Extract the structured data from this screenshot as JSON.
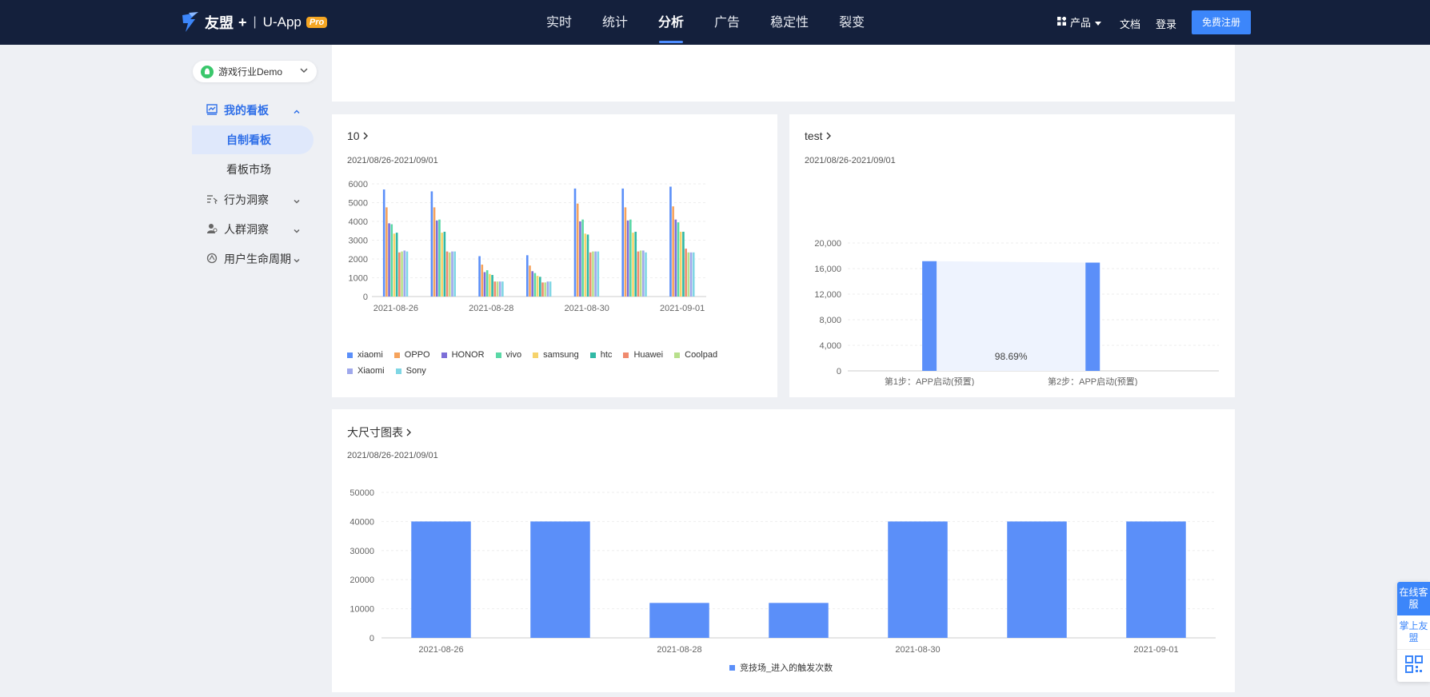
{
  "header": {
    "brand": "友盟",
    "plus": "+",
    "separator": "|",
    "product": "U-App",
    "badge": "Pro",
    "nav": [
      {
        "label": "实时",
        "active": false
      },
      {
        "label": "统计",
        "active": false
      },
      {
        "label": "分析",
        "active": true
      },
      {
        "label": "广告",
        "active": false
      },
      {
        "label": "稳定性",
        "active": false
      },
      {
        "label": "裂变",
        "active": false
      }
    ],
    "products_label": "产品",
    "docs_label": "文档",
    "login_label": "登录",
    "signup_label": "免费注册"
  },
  "sidebar": {
    "app_name": "游戏行业Demo",
    "groups": [
      {
        "label": "我的看板",
        "icon": "dashboard-icon",
        "expanded": true
      },
      {
        "label": "行为洞察",
        "icon": "behavior-icon",
        "expanded": false
      },
      {
        "label": "人群洞察",
        "icon": "people-icon",
        "expanded": false
      },
      {
        "label": "用户生命周期",
        "icon": "lifecycle-icon",
        "expanded": false
      }
    ],
    "sub_items": [
      {
        "label": "自制看板",
        "active": true
      },
      {
        "label": "看板市场",
        "active": false
      }
    ]
  },
  "cards": {
    "card1": {
      "title": "10",
      "date": "2021/08/26-2021/09/01"
    },
    "card2": {
      "title": "test",
      "date": "2021/08/26-2021/09/01"
    },
    "card3": {
      "title": "大尺寸图表",
      "date": "2021/08/26-2021/09/01"
    }
  },
  "chart_data": [
    {
      "type": "bar",
      "x_ticks": [
        "2021-08-26",
        "2021-08-28",
        "2021-08-30",
        "2021-09-01"
      ],
      "categories": [
        "2021-08-26",
        "2021-08-27",
        "2021-08-28",
        "2021-08-29",
        "2021-08-30",
        "2021-08-31",
        "2021-09-01"
      ],
      "ylim": [
        0,
        6000
      ],
      "yticks": [
        0,
        1000,
        2000,
        3000,
        4000,
        5000,
        6000
      ],
      "legend_position": "bottom",
      "series": [
        {
          "name": "xiaomi",
          "color": "#5b8ff9",
          "values": [
            5700,
            5600,
            2150,
            2200,
            5750,
            5750,
            5850
          ]
        },
        {
          "name": "OPPO",
          "color": "#f6a35c",
          "values": [
            4750,
            4750,
            1700,
            1650,
            4950,
            4750,
            4800
          ]
        },
        {
          "name": "HONOR",
          "color": "#7c6fd8",
          "values": [
            3900,
            4050,
            1300,
            1350,
            4000,
            4050,
            4100
          ]
        },
        {
          "name": "vivo",
          "color": "#5ad8a6",
          "values": [
            3850,
            4100,
            1400,
            1250,
            4100,
            4100,
            3950
          ]
        },
        {
          "name": "samsung",
          "color": "#f6d36c",
          "values": [
            3350,
            3400,
            1200,
            1100,
            3350,
            3400,
            3450
          ]
        },
        {
          "name": "htc",
          "color": "#30b9a5",
          "values": [
            3400,
            3450,
            1150,
            1050,
            3300,
            3450,
            3450
          ]
        },
        {
          "name": "Huawei",
          "color": "#f08a6e",
          "values": [
            2350,
            2400,
            800,
            750,
            2350,
            2400,
            2550
          ]
        },
        {
          "name": "Coolpad",
          "color": "#b8e08c",
          "values": [
            2400,
            2350,
            800,
            750,
            2400,
            2450,
            2350
          ]
        },
        {
          "name": "Xiaomi",
          "color": "#9fa8ec",
          "values": [
            2450,
            2400,
            800,
            800,
            2400,
            2450,
            2350
          ]
        },
        {
          "name": "Sony",
          "color": "#7fd6e4",
          "values": [
            2400,
            2400,
            800,
            800,
            2400,
            2350,
            2350
          ]
        }
      ]
    },
    {
      "type": "bar",
      "categories": [
        "第1步：APP启动(预置)",
        "第2步：APP启动(预置)"
      ],
      "values": [
        17155,
        16931
      ],
      "value_labels": [
        "17,155",
        "16,931"
      ],
      "conversion_rate": "98.69%",
      "ylim": [
        0,
        20000
      ],
      "yticks": [
        "0",
        "4,000",
        "8,000",
        "12,000",
        "16,000",
        "20,000"
      ],
      "color": "#5b8ff9"
    },
    {
      "type": "bar",
      "categories": [
        "2021-08-26",
        "2021-08-27",
        "2021-08-28",
        "2021-08-29",
        "2021-08-30",
        "2021-08-31",
        "2021-09-01"
      ],
      "x_ticks": [
        "2021-08-26",
        "2021-08-28",
        "2021-08-30",
        "2021-09-01"
      ],
      "values": [
        40000,
        40000,
        12000,
        12000,
        40000,
        40000,
        40000
      ],
      "ylim": [
        0,
        50000
      ],
      "yticks": [
        0,
        10000,
        20000,
        30000,
        40000,
        50000
      ],
      "legend_position": "bottom",
      "series_name": "竞技场_进入的触发次数",
      "color": "#5b8ff9"
    }
  ],
  "float_panel": {
    "online_service": "在线客服",
    "mobile_app": "掌上友盟"
  }
}
